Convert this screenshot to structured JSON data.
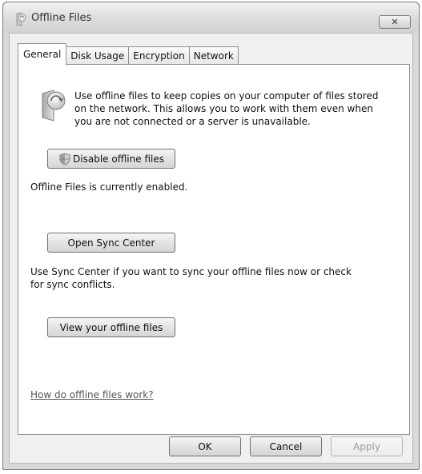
{
  "window": {
    "title": "Offline Files",
    "close_label": "✕"
  },
  "tabs": [
    {
      "label": "General",
      "active": true
    },
    {
      "label": "Disk Usage",
      "active": false
    },
    {
      "label": "Encryption",
      "active": false
    },
    {
      "label": "Network",
      "active": false
    }
  ],
  "general": {
    "description_lines": [
      "Use offline files to keep copies on your computer of files stored",
      "on the network.  This allows you to work with them even when",
      "you are not connected or a server is unavailable."
    ],
    "disable_button": "Disable offline files",
    "status_text": "Offline Files is currently enabled.",
    "sync_button": "Open Sync Center",
    "sync_text_lines": [
      "Use Sync Center if you want to sync your offline files now or check",
      "for sync conflicts."
    ],
    "view_button": "View your offline files",
    "help_link": "How do offline files work?"
  },
  "dialog_buttons": {
    "ok": "OK",
    "cancel": "Cancel",
    "apply": "Apply",
    "apply_enabled": false
  },
  "icons": {
    "window": "offline-files-icon",
    "info": "offline-files-icon",
    "uac": "uac-shield-icon"
  }
}
